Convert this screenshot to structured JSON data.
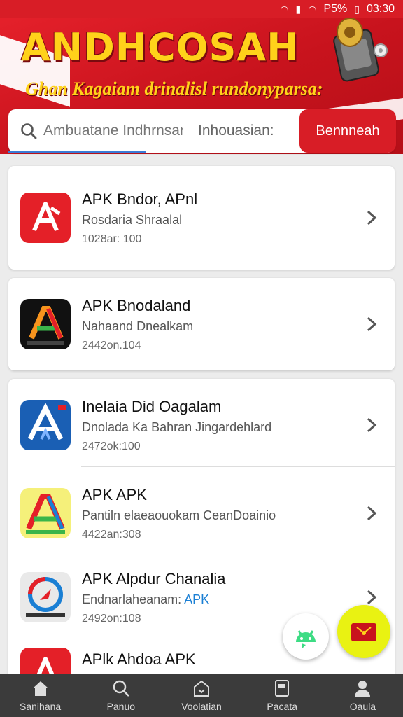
{
  "status_bar": {
    "battery": "P5%",
    "time": "03:30"
  },
  "header": {
    "brand_title": "ANDHCOSAH",
    "brand_subtitle": "Ghan Kagaiam drinalisl rundonyparsa:"
  },
  "search": {
    "placeholder": "Ambuatane Indhrnsan",
    "filter_label": "Inhouasian:",
    "button_label": "Bennneah"
  },
  "apps": [
    {
      "name": "APK Bndor, APnl",
      "desc": "Rosdaria Shraalal",
      "desc_highlight": "",
      "meta": "1028ar: 100",
      "icon": "red-a-icon"
    },
    {
      "name": "APK Bnodaland",
      "desc": "Nahaand Dnealkam",
      "desc_highlight": "",
      "meta": "2442on.104",
      "icon": "colorful-a-icon"
    },
    {
      "name": "Inelaia Did Oagalam",
      "desc": "Dnolada Ka Bahran Jingardehlard",
      "desc_highlight": "",
      "meta": "2472ok:100",
      "icon": "blue-a-icon"
    },
    {
      "name": "APK APK",
      "desc": "Pantiln elaeaouokam CeanDoainio",
      "desc_highlight": "",
      "meta": "4422an:308",
      "icon": "rainbow-a-icon"
    },
    {
      "name": "APK Alpdur Chanalia",
      "desc": "Endnarlaheanam: ",
      "desc_highlight": "APK",
      "meta": "2492on:108",
      "icon": "compass-icon"
    },
    {
      "name": "APlk Ahdoa APK",
      "desc": "",
      "desc_highlight": "",
      "meta": "",
      "icon": "red-a-icon"
    }
  ],
  "bottom_nav": [
    {
      "label": "Sanihana",
      "icon": "home-icon"
    },
    {
      "label": "Panuo",
      "icon": "search-icon"
    },
    {
      "label": "Voolatian",
      "icon": "download-icon"
    },
    {
      "label": "Pacata",
      "icon": "document-icon"
    },
    {
      "label": "Oaula",
      "icon": "profile-icon"
    }
  ],
  "colors": {
    "primary": "#d81d26",
    "accent_yellow": "#ffd21a",
    "nav_bg": "#3b3b3b",
    "link_blue": "#1a7fd4"
  }
}
